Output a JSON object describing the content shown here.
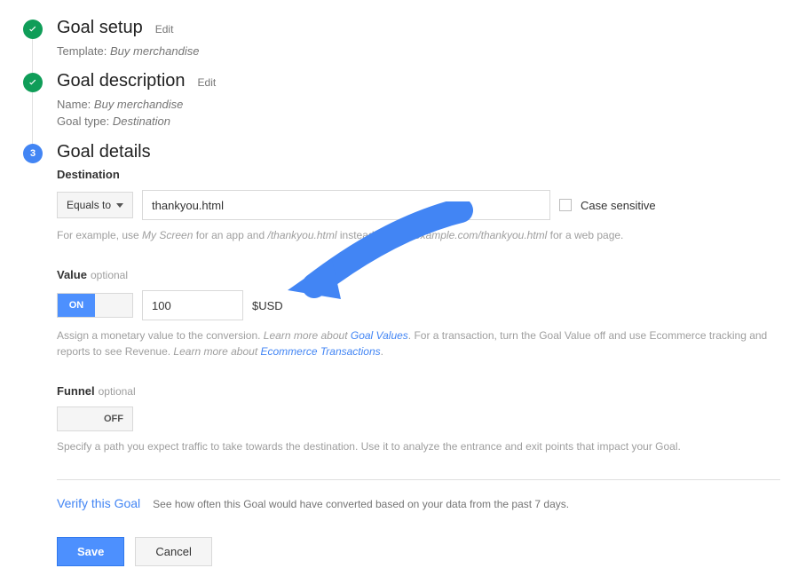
{
  "steps": {
    "setup": {
      "title": "Goal setup",
      "edit": "Edit",
      "template_label": "Template:",
      "template_value": "Buy merchandise"
    },
    "description": {
      "title": "Goal description",
      "edit": "Edit",
      "name_label": "Name:",
      "name_value": "Buy merchandise",
      "type_label": "Goal type:",
      "type_value": "Destination"
    },
    "details": {
      "number": "3",
      "title": "Goal details"
    }
  },
  "destination": {
    "label": "Destination",
    "match": "Equals to",
    "value": "thankyou.html",
    "case_sensitive": "Case sensitive",
    "hint_pre": "For example, use ",
    "hint_screen": "My Screen",
    "hint_mid": " for an app and ",
    "hint_path": "/thankyou.html",
    "hint_mid2": " instead of ",
    "hint_full": "www.example.com/thankyou.html",
    "hint_post": " for a web page."
  },
  "value": {
    "label": "Value",
    "optional": "optional",
    "toggle_on": "ON",
    "amount": "100",
    "currency": "$USD",
    "hint1": "Assign a monetary value to the conversion. ",
    "link1_pre": "Learn more about ",
    "link1": "Goal Values",
    "hint2": ". For a transaction, turn the Goal Value off and use Ecommerce tracking and reports to see Revenue. ",
    "link2_pre": "Learn more about ",
    "link2": "Ecommerce Transactions",
    "dot": "."
  },
  "funnel": {
    "label": "Funnel",
    "optional": "optional",
    "toggle_off": "OFF",
    "hint": "Specify a path you expect traffic to take towards the destination. Use it to analyze the entrance and exit points that impact your Goal."
  },
  "verify": {
    "link": "Verify this Goal",
    "desc": "See how often this Goal would have converted based on your data from the past 7 days."
  },
  "buttons": {
    "save": "Save",
    "cancel": "Cancel"
  }
}
